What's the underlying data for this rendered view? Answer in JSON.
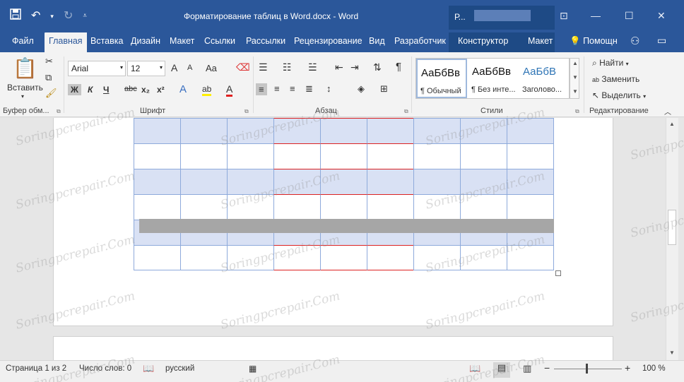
{
  "titlebar": {
    "title": "Форматирование таблиц в Word.docx - Word",
    "save_icon": "save-icon",
    "undo_icon": "undo-icon",
    "redo_icon": "redo-icon",
    "customize_icon": "customize-qat-icon",
    "context_label": "Р...",
    "minimize": "—",
    "maximize": "☐",
    "close": "✕",
    "ribbon_display": "⊡"
  },
  "tabs": [
    {
      "label": "Файл"
    },
    {
      "label": "Главная"
    },
    {
      "label": "Вставка"
    },
    {
      "label": "Дизайн"
    },
    {
      "label": "Макет"
    },
    {
      "label": "Ссылки"
    },
    {
      "label": "Рассылки"
    },
    {
      "label": "Рецензирование"
    },
    {
      "label": "Вид"
    },
    {
      "label": "Разработчик"
    },
    {
      "label": "Конструктор"
    },
    {
      "label": "Макет"
    }
  ],
  "help": "Помощн",
  "ribbon": {
    "clipboard": {
      "paste": "Вставить",
      "label": "Буфер обм..."
    },
    "font": {
      "name": "Arial",
      "size": "12",
      "grow": "A",
      "shrink": "A",
      "case": "Aa",
      "bold": "Ж",
      "italic": "К",
      "underline": "Ч",
      "strike": "abc",
      "sub": "x₂",
      "sup": "x²",
      "effects": "A",
      "highlight": "ab",
      "color": "A",
      "label": "Шрифт"
    },
    "paragraph": {
      "label": "Абзац"
    },
    "styles": {
      "items": [
        {
          "sample": "АаБбВв",
          "name": "¶ Обычный"
        },
        {
          "sample": "АаБбВв",
          "name": "¶ Без инте..."
        },
        {
          "sample": "АаБбВ",
          "name": "Заголово..."
        }
      ],
      "label": "Стили"
    },
    "editing": {
      "find": "Найти",
      "replace": "Заменить",
      "select": "Выделить",
      "label": "Редактирование"
    }
  },
  "statusbar": {
    "page": "Страница 1 из 2",
    "words": "Число слов: 0",
    "language": "русский",
    "zoom_minus": "−",
    "zoom_plus": "+",
    "zoom": "100 %"
  },
  "watermark": "Soringpcrepair.Com",
  "colors": {
    "accent": "#2b579a",
    "table_border": "#8eaadb",
    "shade": "#d9e1f4",
    "red_border": "#d22222"
  }
}
